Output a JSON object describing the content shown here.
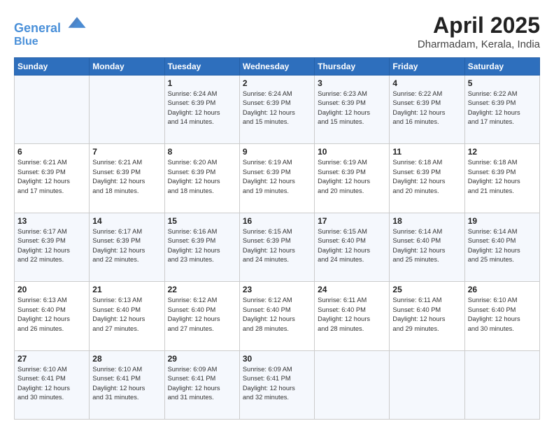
{
  "header": {
    "logo_line1": "General",
    "logo_line2": "Blue",
    "month": "April 2025",
    "location": "Dharmadam, Kerala, India"
  },
  "weekdays": [
    "Sunday",
    "Monday",
    "Tuesday",
    "Wednesday",
    "Thursday",
    "Friday",
    "Saturday"
  ],
  "weeks": [
    [
      {
        "day": "",
        "info": ""
      },
      {
        "day": "",
        "info": ""
      },
      {
        "day": "1",
        "info": "Sunrise: 6:24 AM\nSunset: 6:39 PM\nDaylight: 12 hours\nand 14 minutes."
      },
      {
        "day": "2",
        "info": "Sunrise: 6:24 AM\nSunset: 6:39 PM\nDaylight: 12 hours\nand 15 minutes."
      },
      {
        "day": "3",
        "info": "Sunrise: 6:23 AM\nSunset: 6:39 PM\nDaylight: 12 hours\nand 15 minutes."
      },
      {
        "day": "4",
        "info": "Sunrise: 6:22 AM\nSunset: 6:39 PM\nDaylight: 12 hours\nand 16 minutes."
      },
      {
        "day": "5",
        "info": "Sunrise: 6:22 AM\nSunset: 6:39 PM\nDaylight: 12 hours\nand 17 minutes."
      }
    ],
    [
      {
        "day": "6",
        "info": "Sunrise: 6:21 AM\nSunset: 6:39 PM\nDaylight: 12 hours\nand 17 minutes."
      },
      {
        "day": "7",
        "info": "Sunrise: 6:21 AM\nSunset: 6:39 PM\nDaylight: 12 hours\nand 18 minutes."
      },
      {
        "day": "8",
        "info": "Sunrise: 6:20 AM\nSunset: 6:39 PM\nDaylight: 12 hours\nand 18 minutes."
      },
      {
        "day": "9",
        "info": "Sunrise: 6:19 AM\nSunset: 6:39 PM\nDaylight: 12 hours\nand 19 minutes."
      },
      {
        "day": "10",
        "info": "Sunrise: 6:19 AM\nSunset: 6:39 PM\nDaylight: 12 hours\nand 20 minutes."
      },
      {
        "day": "11",
        "info": "Sunrise: 6:18 AM\nSunset: 6:39 PM\nDaylight: 12 hours\nand 20 minutes."
      },
      {
        "day": "12",
        "info": "Sunrise: 6:18 AM\nSunset: 6:39 PM\nDaylight: 12 hours\nand 21 minutes."
      }
    ],
    [
      {
        "day": "13",
        "info": "Sunrise: 6:17 AM\nSunset: 6:39 PM\nDaylight: 12 hours\nand 22 minutes."
      },
      {
        "day": "14",
        "info": "Sunrise: 6:17 AM\nSunset: 6:39 PM\nDaylight: 12 hours\nand 22 minutes."
      },
      {
        "day": "15",
        "info": "Sunrise: 6:16 AM\nSunset: 6:39 PM\nDaylight: 12 hours\nand 23 minutes."
      },
      {
        "day": "16",
        "info": "Sunrise: 6:15 AM\nSunset: 6:39 PM\nDaylight: 12 hours\nand 24 minutes."
      },
      {
        "day": "17",
        "info": "Sunrise: 6:15 AM\nSunset: 6:40 PM\nDaylight: 12 hours\nand 24 minutes."
      },
      {
        "day": "18",
        "info": "Sunrise: 6:14 AM\nSunset: 6:40 PM\nDaylight: 12 hours\nand 25 minutes."
      },
      {
        "day": "19",
        "info": "Sunrise: 6:14 AM\nSunset: 6:40 PM\nDaylight: 12 hours\nand 25 minutes."
      }
    ],
    [
      {
        "day": "20",
        "info": "Sunrise: 6:13 AM\nSunset: 6:40 PM\nDaylight: 12 hours\nand 26 minutes."
      },
      {
        "day": "21",
        "info": "Sunrise: 6:13 AM\nSunset: 6:40 PM\nDaylight: 12 hours\nand 27 minutes."
      },
      {
        "day": "22",
        "info": "Sunrise: 6:12 AM\nSunset: 6:40 PM\nDaylight: 12 hours\nand 27 minutes."
      },
      {
        "day": "23",
        "info": "Sunrise: 6:12 AM\nSunset: 6:40 PM\nDaylight: 12 hours\nand 28 minutes."
      },
      {
        "day": "24",
        "info": "Sunrise: 6:11 AM\nSunset: 6:40 PM\nDaylight: 12 hours\nand 28 minutes."
      },
      {
        "day": "25",
        "info": "Sunrise: 6:11 AM\nSunset: 6:40 PM\nDaylight: 12 hours\nand 29 minutes."
      },
      {
        "day": "26",
        "info": "Sunrise: 6:10 AM\nSunset: 6:40 PM\nDaylight: 12 hours\nand 30 minutes."
      }
    ],
    [
      {
        "day": "27",
        "info": "Sunrise: 6:10 AM\nSunset: 6:41 PM\nDaylight: 12 hours\nand 30 minutes."
      },
      {
        "day": "28",
        "info": "Sunrise: 6:10 AM\nSunset: 6:41 PM\nDaylight: 12 hours\nand 31 minutes."
      },
      {
        "day": "29",
        "info": "Sunrise: 6:09 AM\nSunset: 6:41 PM\nDaylight: 12 hours\nand 31 minutes."
      },
      {
        "day": "30",
        "info": "Sunrise: 6:09 AM\nSunset: 6:41 PM\nDaylight: 12 hours\nand 32 minutes."
      },
      {
        "day": "",
        "info": ""
      },
      {
        "day": "",
        "info": ""
      },
      {
        "day": "",
        "info": ""
      }
    ]
  ]
}
